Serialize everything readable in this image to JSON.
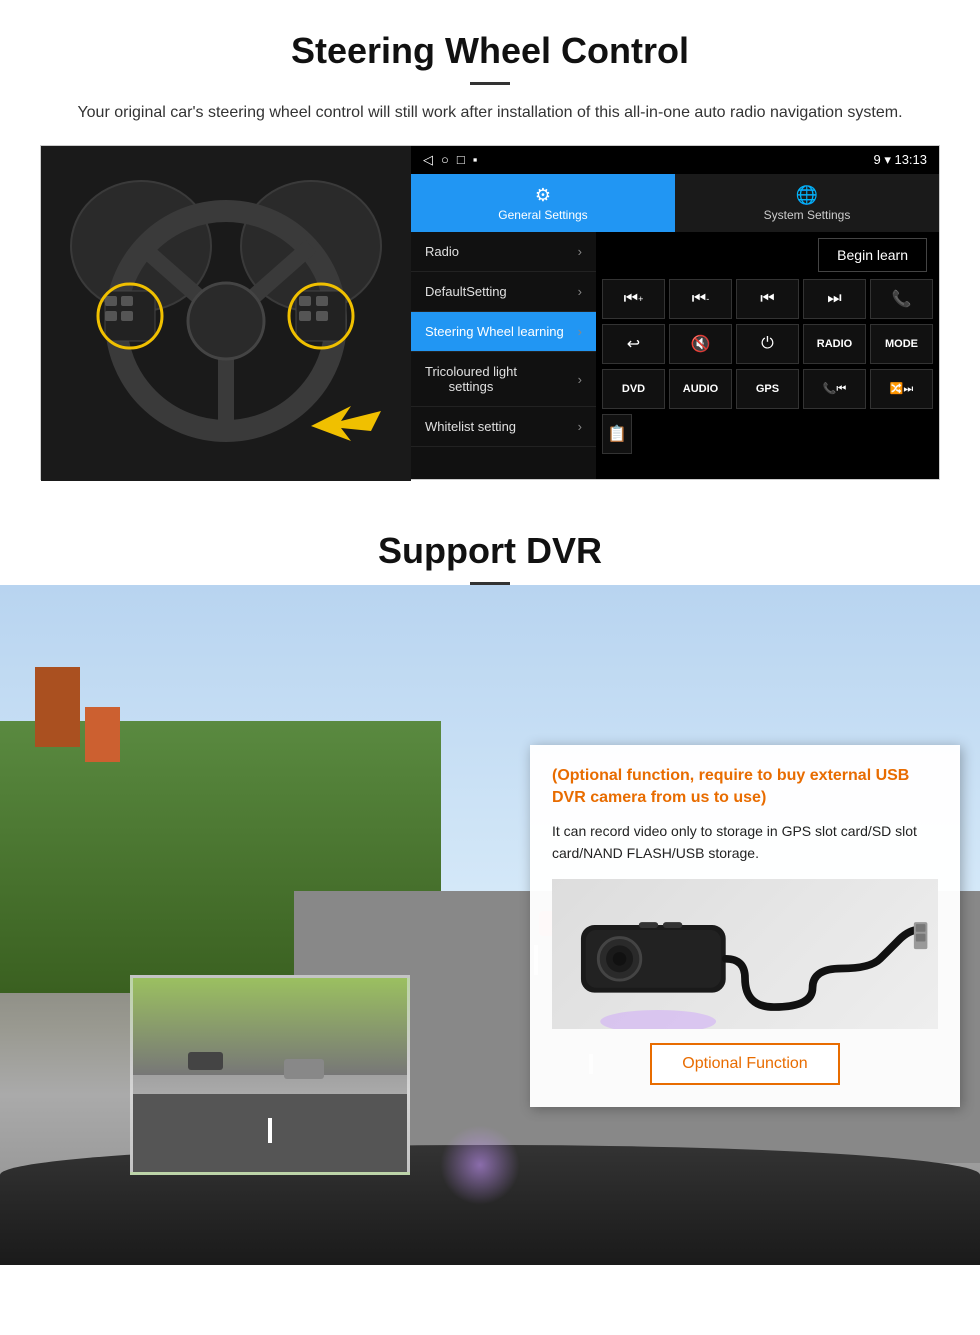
{
  "page": {
    "section1": {
      "title": "Steering Wheel Control",
      "description": "Your original car's steering wheel control will still work after installation of this all-in-one auto radio navigation system.",
      "statusbar": {
        "left_icons": [
          "◁",
          "○",
          "□",
          "▪"
        ],
        "right": "9 ▾ 13:13"
      },
      "tabs": [
        {
          "icon": "⚙",
          "label": "General Settings",
          "active": true
        },
        {
          "icon": "🌐",
          "label": "System Settings",
          "active": false
        }
      ],
      "menu_items": [
        {
          "label": "Radio",
          "active": false
        },
        {
          "label": "DefaultSetting",
          "active": false
        },
        {
          "label": "Steering Wheel learning",
          "active": true
        },
        {
          "label": "Tricoloured light settings",
          "active": false
        },
        {
          "label": "Whitelist setting",
          "active": false
        }
      ],
      "begin_learn_label": "Begin learn",
      "control_buttons": [
        [
          "⏮+",
          "⏮-",
          "⏮⏮",
          "⏭⏭",
          "📞"
        ],
        [
          "↩",
          "🔇",
          "⏻",
          "RADIO",
          "MODE"
        ],
        [
          "DVD",
          "AUDIO",
          "GPS",
          "📞⏮",
          "🔀⏭"
        ],
        [
          "📋"
        ]
      ]
    },
    "section2": {
      "title": "Support DVR",
      "orange_text": "(Optional function, require to buy external USB DVR camera from us to use)",
      "normal_text": "It can record video only to storage in GPS slot card/SD slot card/NAND FLASH/USB storage.",
      "optional_fn_label": "Optional Function"
    }
  }
}
